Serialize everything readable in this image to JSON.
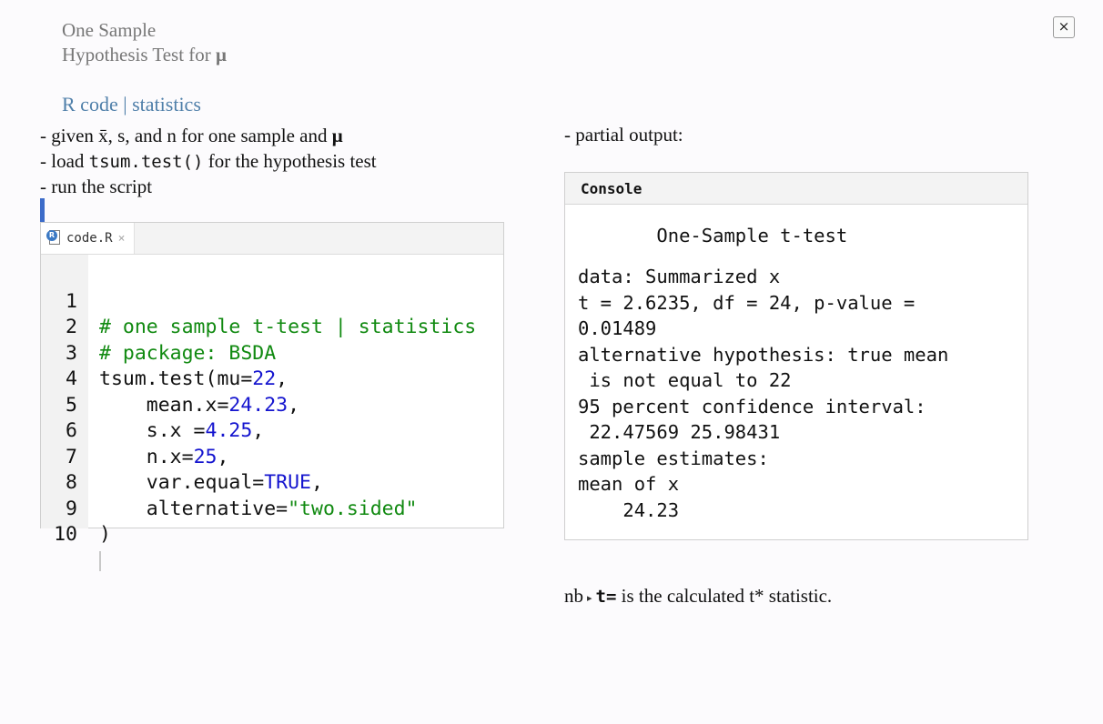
{
  "header": {
    "title_line1": "One Sample",
    "title_line2_text": "Hypothesis Test for",
    "title_line2_symbol": "μ",
    "subtitle": "R code | statistics",
    "close_label": "×"
  },
  "instructions": {
    "line1_text": "- given x̄, s, and n for one sample and",
    "line1_symbol": "μ",
    "line2_prefix": "- load",
    "line2_code": "tsum.test()",
    "line2_suffix": "for the hypothesis test",
    "line3": "- run the script"
  },
  "editor": {
    "tab_label": "code.R",
    "tab_close": "×",
    "icon_letter": "R",
    "line_numbers": [
      "1",
      "2",
      "3",
      "4",
      "5",
      "6",
      "7",
      "8",
      "9",
      "10"
    ],
    "lines": {
      "l1": "# one sample t-test | statistics",
      "l2": "# package: BSDA",
      "l3_a": "tsum.test(mu=",
      "l3_b": "22",
      "l3_c": ",",
      "l4_a": "    mean.x=",
      "l4_b": "24.23",
      "l4_c": ",",
      "l5_a": "    s.x =",
      "l5_b": "4.25",
      "l5_c": ",",
      "l6_a": "    n.x=",
      "l6_b": "25",
      "l6_c": ",",
      "l7_a": "    var.equal=",
      "l7_b": "TRUE",
      "l7_c": ",",
      "l8_a": "    alternative=",
      "l8_b": "\"two.sided\"",
      "l9": ")"
    }
  },
  "output": {
    "label": "- partial output:",
    "console_title": "Console",
    "lines": [
      "       One-Sample t-test",
      "data: Summarized x",
      "t = 2.6235, df = 24, p-value =",
      "0.01489",
      "alternative hypothesis: true mean",
      " is not equal to 22",
      "95 percent confidence interval:",
      " 22.47569 25.98431",
      "sample estimates:",
      "mean of x",
      "    24.23"
    ]
  },
  "note": {
    "prefix": "nb",
    "arrow": "▸",
    "code": "t=",
    "text": "is the calculated t* statistic."
  }
}
